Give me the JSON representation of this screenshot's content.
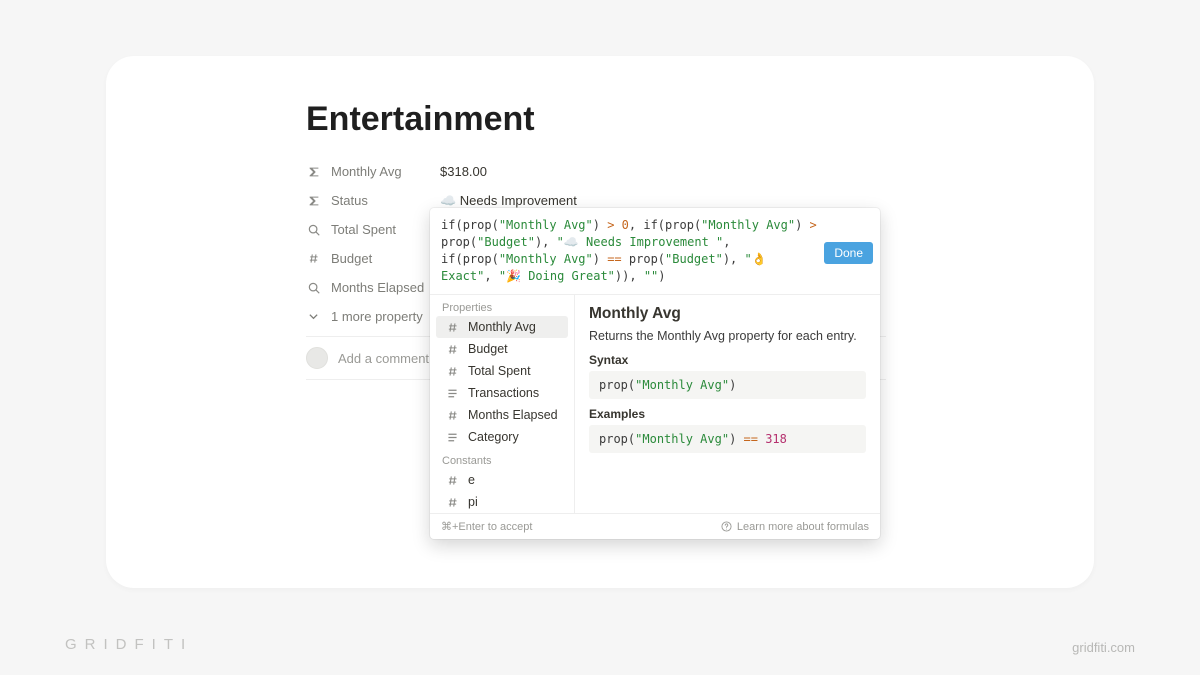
{
  "page": {
    "title": "Entertainment",
    "properties": [
      {
        "icon": "sigma",
        "label": "Monthly Avg",
        "value": "$318.00"
      },
      {
        "icon": "sigma",
        "label": "Status",
        "value": "☁️ Needs Improvement"
      },
      {
        "icon": "search",
        "label": "Total Spent",
        "value": ""
      },
      {
        "icon": "hash",
        "label": "Budget",
        "value": ""
      },
      {
        "icon": "search",
        "label": "Months Elapsed",
        "value": ""
      }
    ],
    "more_label": "1 more property",
    "comment_placeholder": "Add a comment..."
  },
  "popup": {
    "formula_tokens": [
      {
        "t": "fn",
        "v": "if"
      },
      {
        "t": "p",
        "v": "("
      },
      {
        "t": "fn",
        "v": "prop"
      },
      {
        "t": "p",
        "v": "("
      },
      {
        "t": "str",
        "v": "\"Monthly Avg\""
      },
      {
        "t": "p",
        "v": ") "
      },
      {
        "t": "op",
        "v": "> "
      },
      {
        "t": "n",
        "v": "0"
      },
      {
        "t": "p",
        "v": ", "
      },
      {
        "t": "fn",
        "v": "if"
      },
      {
        "t": "p",
        "v": "("
      },
      {
        "t": "fn",
        "v": "prop"
      },
      {
        "t": "p",
        "v": "("
      },
      {
        "t": "str",
        "v": "\"Monthly Avg\""
      },
      {
        "t": "p",
        "v": ") "
      },
      {
        "t": "op",
        "v": "> "
      },
      {
        "t": "fn",
        "v": "prop"
      },
      {
        "t": "p",
        "v": "("
      },
      {
        "t": "str",
        "v": "\"Budget\""
      },
      {
        "t": "p",
        "v": "), "
      },
      {
        "t": "str",
        "v": "\"☁️ Needs Improvement \""
      },
      {
        "t": "p",
        "v": ", "
      },
      {
        "t": "fn",
        "v": "if"
      },
      {
        "t": "p",
        "v": "("
      },
      {
        "t": "fn",
        "v": "prop"
      },
      {
        "t": "p",
        "v": "("
      },
      {
        "t": "str",
        "v": "\"Monthly Avg\""
      },
      {
        "t": "p",
        "v": ") "
      },
      {
        "t": "op",
        "v": "== "
      },
      {
        "t": "fn",
        "v": "prop"
      },
      {
        "t": "p",
        "v": "("
      },
      {
        "t": "str",
        "v": "\"Budget\""
      },
      {
        "t": "p",
        "v": "), "
      },
      {
        "t": "str",
        "v": "\"👌 Exact\""
      },
      {
        "t": "p",
        "v": ", "
      },
      {
        "t": "str",
        "v": "\"🎉 Doing Great\""
      },
      {
        "t": "p",
        "v": ")), "
      },
      {
        "t": "str",
        "v": "\"\""
      },
      {
        "t": "p",
        "v": ")"
      }
    ],
    "done_label": "Done",
    "groups": [
      {
        "label": "Properties",
        "items": [
          {
            "icon": "hash",
            "label": "Monthly Avg",
            "selected": true
          },
          {
            "icon": "hash",
            "label": "Budget"
          },
          {
            "icon": "hash",
            "label": "Total Spent"
          },
          {
            "icon": "lines",
            "label": "Transactions"
          },
          {
            "icon": "hash",
            "label": "Months Elapsed"
          },
          {
            "icon": "lines",
            "label": "Category"
          }
        ]
      },
      {
        "label": "Constants",
        "items": [
          {
            "icon": "hash",
            "label": "e"
          },
          {
            "icon": "hash",
            "label": "pi"
          }
        ]
      }
    ],
    "detail": {
      "title": "Monthly Avg",
      "desc": "Returns the Monthly Avg property for each entry.",
      "syntax_label": "Syntax",
      "syntax_tokens": [
        {
          "t": "fn",
          "v": "prop"
        },
        {
          "t": "p",
          "v": "("
        },
        {
          "t": "str",
          "v": "\"Monthly Avg\""
        },
        {
          "t": "p",
          "v": ")"
        }
      ],
      "examples_label": "Examples",
      "example_tokens": [
        {
          "t": "fn",
          "v": "prop"
        },
        {
          "t": "p",
          "v": "("
        },
        {
          "t": "str",
          "v": "\"Monthly Avg\""
        },
        {
          "t": "p",
          "v": ") "
        },
        {
          "t": "op",
          "v": "== "
        },
        {
          "t": "num",
          "v": "318"
        }
      ]
    },
    "footer": {
      "accept": "⌘+Enter to accept",
      "learn": "Learn more about formulas"
    }
  },
  "branding": {
    "logo": "GRIDFITI",
    "url": "gridfiti.com"
  }
}
